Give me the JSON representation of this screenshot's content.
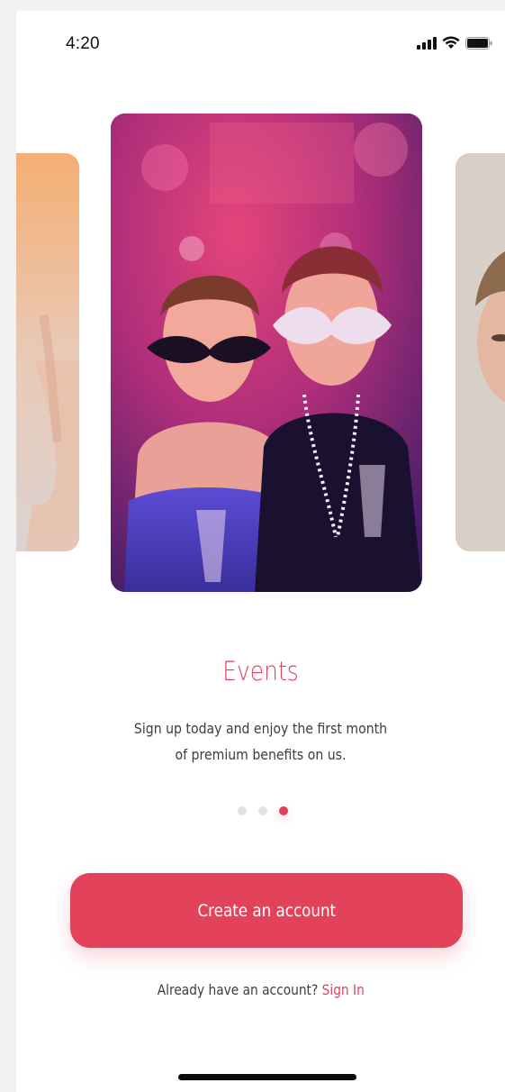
{
  "status_bar": {
    "time": "4:20",
    "icons": [
      "cellular-signal-icon",
      "wifi-icon",
      "battery-icon"
    ]
  },
  "carousel": {
    "images": [
      {
        "name": "previous-event-photo"
      },
      {
        "name": "masquerade-party-photo"
      },
      {
        "name": "next-event-photo"
      }
    ],
    "active_index": 2,
    "page_count": 3
  },
  "onboarding": {
    "title": "Events",
    "subtitle_line1": "Sign up today and enjoy the first month",
    "subtitle_line2": "of premium benefits on us."
  },
  "actions": {
    "create_account_label": "Create an account",
    "already_have_account_text": "Already have an account?",
    "sign_in_label": "Sign In"
  },
  "colors": {
    "accent": "#e3425b",
    "text": "#3c3c44",
    "dot_inactive": "#e2e2e6",
    "background": "#ffffff"
  }
}
